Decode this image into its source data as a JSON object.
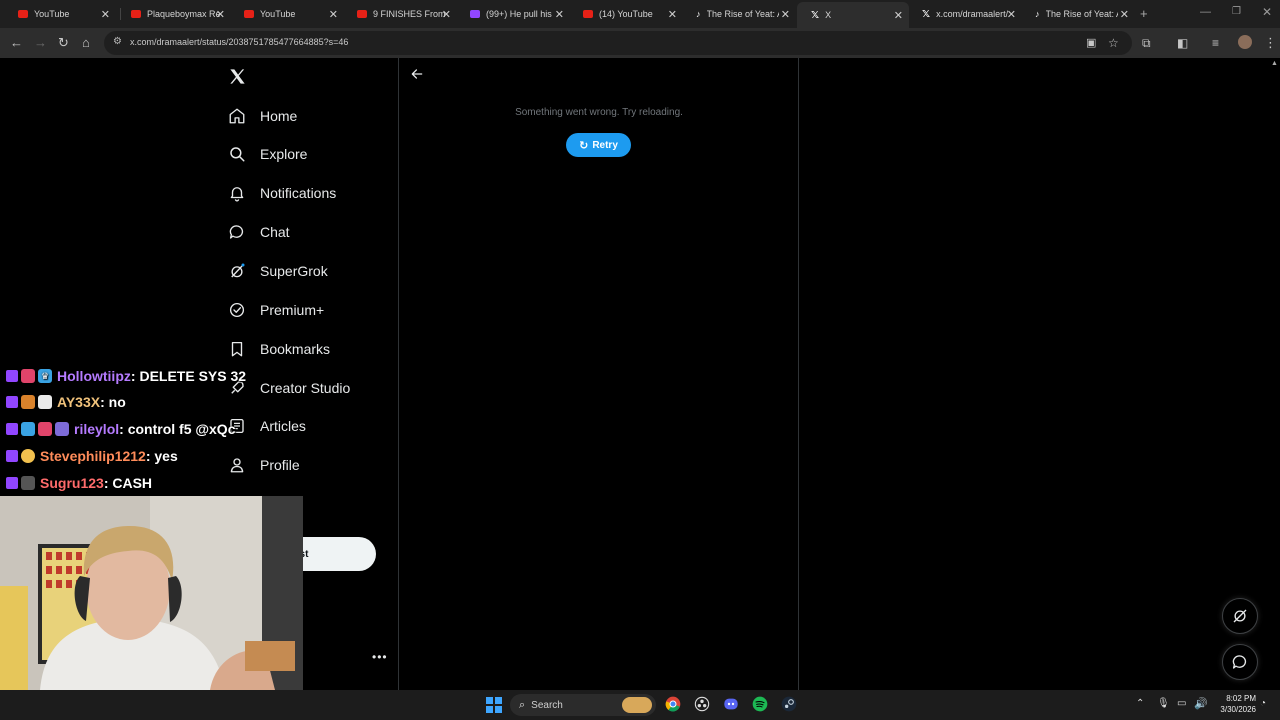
{
  "tabs": [
    {
      "title": "YouTube",
      "icon": "youtube-icon",
      "active": false
    },
    {
      "title": "Plaqueboymax Re",
      "icon": "youtube-icon",
      "active": false
    },
    {
      "title": "YouTube",
      "icon": "youtube-icon",
      "active": false
    },
    {
      "title": "9 FINISHES From",
      "icon": "youtube-icon",
      "active": false
    },
    {
      "title": "(99+) He pull his",
      "icon": "twitch-icon",
      "active": false
    },
    {
      "title": "(14) YouTube",
      "icon": "youtube-icon",
      "active": false
    },
    {
      "title": "The Rise of Yeat: A",
      "icon": "tiktok-icon",
      "active": false
    },
    {
      "title": "X",
      "icon": "x-icon",
      "active": true
    },
    {
      "title": "x.com/dramaalert/",
      "icon": "x-icon",
      "active": false
    },
    {
      "title": "The Rise of Yeat: A",
      "icon": "tiktok-icon",
      "active": false
    }
  ],
  "address_bar": {
    "url": "x.com/dramaalert/status/2038751785477664885?s=46"
  },
  "sidebar": {
    "items": [
      {
        "label": "Home",
        "icon": "home-icon"
      },
      {
        "label": "Explore",
        "icon": "search-icon"
      },
      {
        "label": "Notifications",
        "icon": "bell-icon"
      },
      {
        "label": "Chat",
        "icon": "chat-bubble-icon"
      },
      {
        "label": "SuperGrok",
        "icon": "grok-icon"
      },
      {
        "label": "Premium+",
        "icon": "verified-icon"
      },
      {
        "label": "Bookmarks",
        "icon": "bookmark-icon"
      },
      {
        "label": "Creator Studio",
        "icon": "rocket-icon"
      },
      {
        "label": "Articles",
        "icon": "article-icon"
      },
      {
        "label": "Profile",
        "icon": "person-icon"
      }
    ],
    "post_button_label": "st"
  },
  "main": {
    "error_message": "Something went wrong. Try reloading.",
    "retry_label": "Retry"
  },
  "chat": [
    {
      "user": "Hollowtiipz",
      "message": "DELETE SYS 32",
      "user_color": "#b57bff"
    },
    {
      "user": "AY33X",
      "message": "no",
      "user_color": "#f0c27b"
    },
    {
      "user": "rileylol",
      "message": "control f5 @xQc",
      "user_color": "#b57bff"
    },
    {
      "user": "Stevephilip1212",
      "message": "yes",
      "user_color": "#ff8c5a"
    },
    {
      "user": "Sugru123",
      "message": "CASH",
      "user_color": "#ff6b6b"
    }
  ],
  "taskbar": {
    "search_label": "Search",
    "time": "8:02 PM",
    "date": "3/30/2026"
  },
  "colors": {
    "accent": "#1d9bf0",
    "background": "#000000",
    "border": "#2f3336"
  }
}
